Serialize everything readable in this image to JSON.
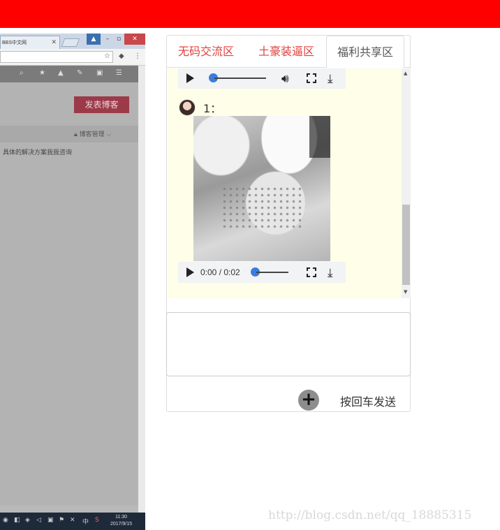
{
  "embedded_browser": {
    "tab_title": "BBS中文网",
    "publish_button": "发表博客",
    "blog_manage": "博客管理",
    "hint_text": "具体的解决方案我我咨询",
    "taskbar_time": "11:30",
    "taskbar_date": "2017/9/15",
    "ime_label": "中"
  },
  "chat": {
    "tabs": [
      {
        "label": "无码交流区",
        "active": false
      },
      {
        "label": "土豪装逼区",
        "active": false
      },
      {
        "label": "福利共享区",
        "active": true
      }
    ],
    "audio_players": [
      {
        "time": "",
        "progress": 0
      },
      {
        "time": "0:00 / 0:02",
        "progress": 0
      }
    ],
    "message": {
      "user": "1："
    },
    "input_placeholder": "",
    "send_hint": "按回车发送"
  },
  "watermark": "http://blog.csdn.net/qq_18885315",
  "colors": {
    "topbar": "#ff0000",
    "tab_text": "#e0413e",
    "chat_bg": "#fefee9",
    "slider": "#3b7ddd"
  }
}
